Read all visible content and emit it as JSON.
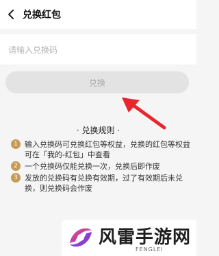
{
  "header": {
    "back_icon": "chevron-left-icon",
    "title": "兑换红包"
  },
  "redeem_input": {
    "placeholder": "请输入兑换码",
    "value": ""
  },
  "redeem_button": {
    "label": "兑换",
    "state": "disabled"
  },
  "rules": {
    "title": "· 兑换规则 ·",
    "items": [
      {
        "num": "1",
        "text": "输入兑换码可兑换红包等权益，兑换的红包等权益可在「我的-红包」中查看"
      },
      {
        "num": "2",
        "text": "一个兑换码仅能兑换一次，兑换后即作废"
      },
      {
        "num": "3",
        "text": "发放的兑换码有兑换有效期，过了有效期后未兑换，则兑换码会作废"
      }
    ]
  },
  "watermark": {
    "text": "风雷手游网",
    "subtext": "FENGLEI"
  },
  "colors": {
    "arrow": "#e8262d",
    "rule_number_badge": "#c79a55",
    "button_bg": "#e3e3e3"
  }
}
